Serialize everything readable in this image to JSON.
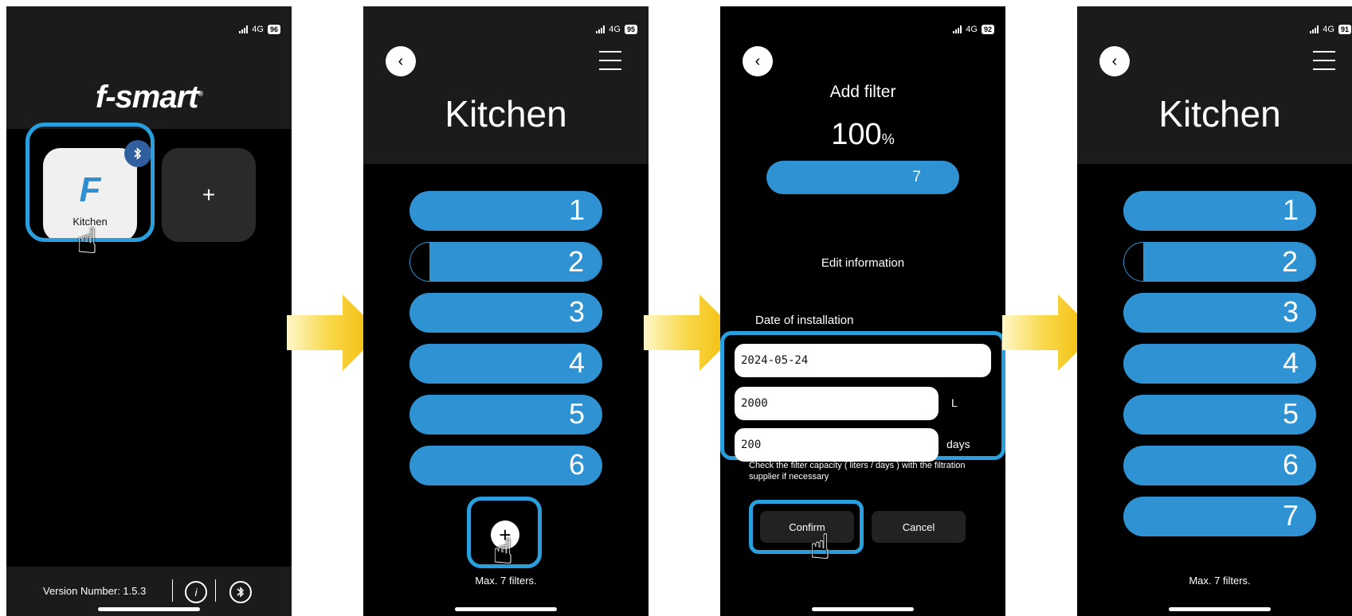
{
  "status": [
    {
      "network": "4G",
      "battery": "96"
    },
    {
      "network": "4G",
      "battery": "95"
    },
    {
      "network": "4G",
      "battery": "92"
    },
    {
      "network": "4G",
      "battery": "91"
    }
  ],
  "screen1": {
    "logo": "f-smart",
    "logo_mark": "®",
    "tile_letter": "F",
    "device_label": "Kitchen",
    "add_label": "+",
    "version": "Version Number: 1.5.3"
  },
  "screen2": {
    "title": "Kitchen",
    "filters": [
      "1",
      "2",
      "3",
      "4",
      "5",
      "6"
    ],
    "add_label": "+",
    "max_text": "Max. 7 filters."
  },
  "screen3": {
    "title": "Add filter",
    "percent": "100",
    "percent_unit": "%",
    "bar_number": "7",
    "edit_info": "Edit information",
    "date_label": "Date of installation",
    "date_value": "2024-05-24",
    "liters_value": "2000",
    "liters_unit": "L",
    "days_value": "200",
    "days_unit": "days",
    "hint": "Check the filter capacity ( liters / days ) with the filtration supplier if necessary",
    "confirm_label": "Confirm",
    "cancel_label": "Cancel"
  },
  "screen4": {
    "title": "Kitchen",
    "filters": [
      "1",
      "2",
      "3",
      "4",
      "5",
      "6",
      "7"
    ],
    "max_text": "Max. 7 filters."
  },
  "colors": {
    "accent": "#2f93d3",
    "highlight": "#2a9fde",
    "arrow": "#f5c400"
  },
  "icons": [
    "back-icon",
    "menu-icon",
    "bluetooth-icon",
    "info-icon",
    "plus-icon",
    "hand-pointer-icon",
    "arrow-right-icon"
  ]
}
